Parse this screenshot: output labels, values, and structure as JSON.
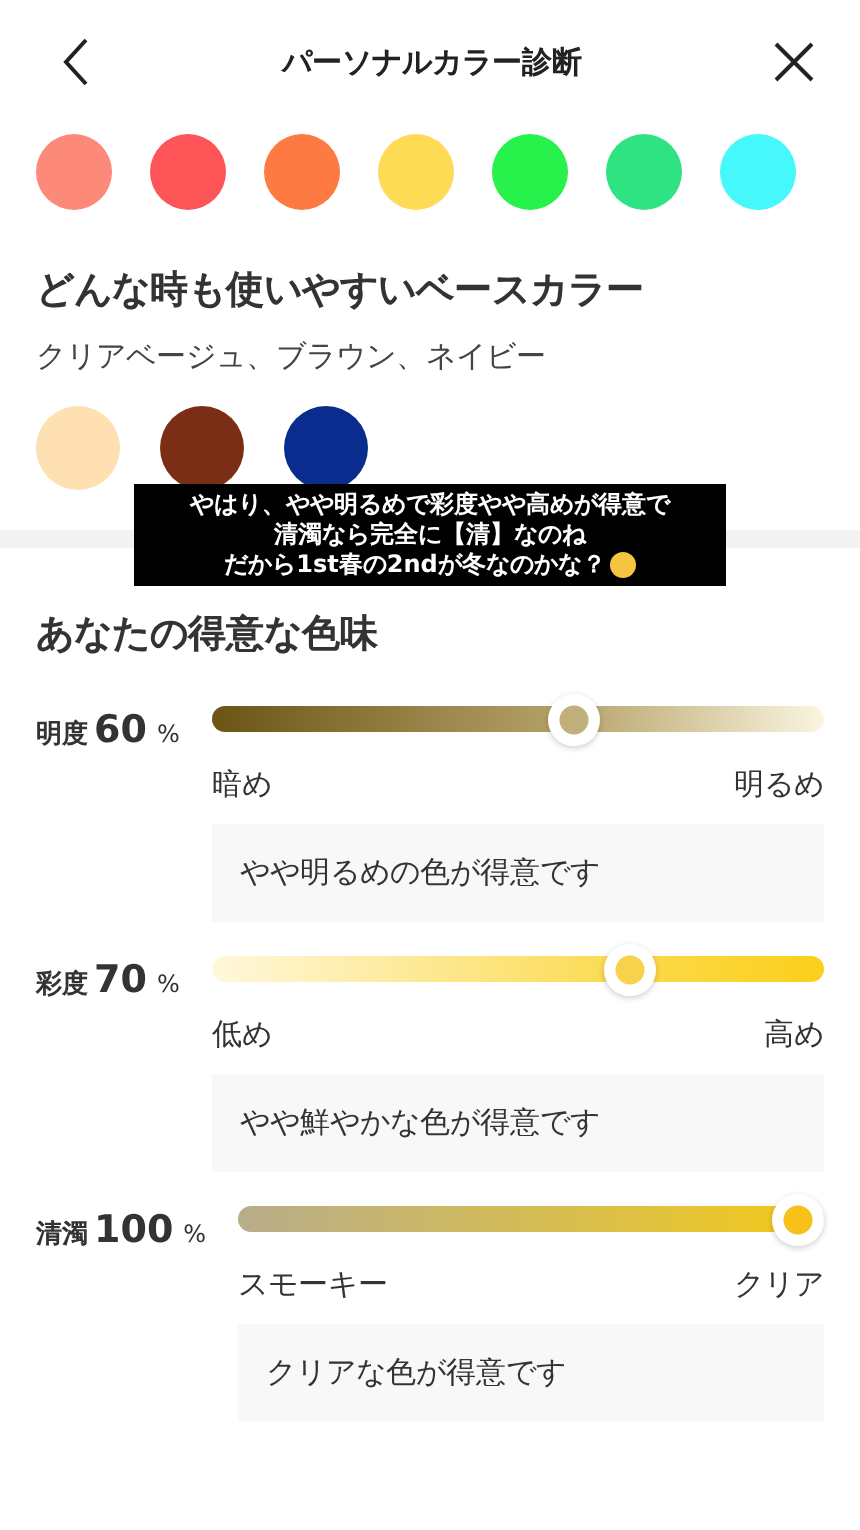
{
  "header": {
    "title": "パーソナルカラー診断"
  },
  "top_swatches": [
    {
      "color": "#fd8a78"
    },
    {
      "color": "#fd5457"
    },
    {
      "color": "#fd7a43"
    },
    {
      "color": "#fedb55"
    },
    {
      "color": "#27f24c"
    },
    {
      "color": "#2fe382"
    },
    {
      "color": "#46f7fb"
    }
  ],
  "base_colors": {
    "title": "どんな時も使いやすいベースカラー",
    "subtitle": "クリアベージュ、ブラウン、ネイビー",
    "swatches": [
      {
        "color": "#ffe0b3"
      },
      {
        "color": "#7a2e16"
      },
      {
        "color": "#0a2c8f"
      }
    ]
  },
  "caption": {
    "lines": [
      "やはり、やや明るめで彩度やや高めが得意で",
      "清濁なら完全に【清】なのね",
      "だから1st春の2ndが冬なのかな？"
    ]
  },
  "traits": {
    "title": "あなたの得意な色味",
    "rows": [
      {
        "kind": "brightness",
        "name": "明度",
        "value": "60",
        "unit": "%",
        "level": 0.6,
        "low": "暗め",
        "high": "明るめ",
        "note": "やや明るめの色が得意です"
      },
      {
        "kind": "saturation",
        "name": "彩度",
        "value": "70",
        "unit": "%",
        "level": 0.7,
        "low": "低め",
        "high": "高め",
        "note": "やや鮮やかな色が得意です"
      },
      {
        "kind": "clarity",
        "name": "清濁",
        "value": "100",
        "unit": "%",
        "level": 1,
        "low": "スモーキー",
        "high": "クリア",
        "note": "クリアな色が得意です"
      }
    ]
  }
}
